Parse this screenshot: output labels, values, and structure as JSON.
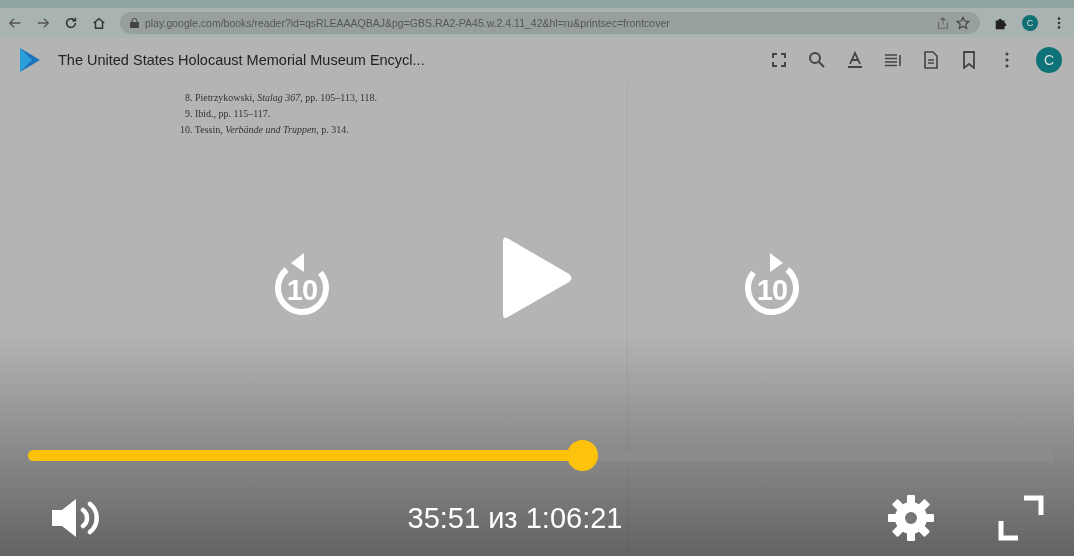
{
  "browser": {
    "url": "play.google.com/books/reader?id=qsRLEAAAQBAJ&pg=GBS.RA2-PA45.w.2.4.11_42&hl=ru&printsec=frontcover",
    "profile_initial": "C"
  },
  "book": {
    "title": "The United States Holocaust Memorial Museum Encycl...",
    "avatar_initial": "C",
    "footnotes": [
      "8. Pietrzykowski, *Stalag 367*, pp. 105–113, 118.",
      "9. Ibid., pp. 115–117.",
      "10. Tessin, *Verbände und Truppen*, p. 314."
    ]
  },
  "player": {
    "replay_label": "10",
    "forward_label": "10",
    "progress": {
      "level": 0.54
    },
    "time": "35:51 из 1:06:21"
  }
}
